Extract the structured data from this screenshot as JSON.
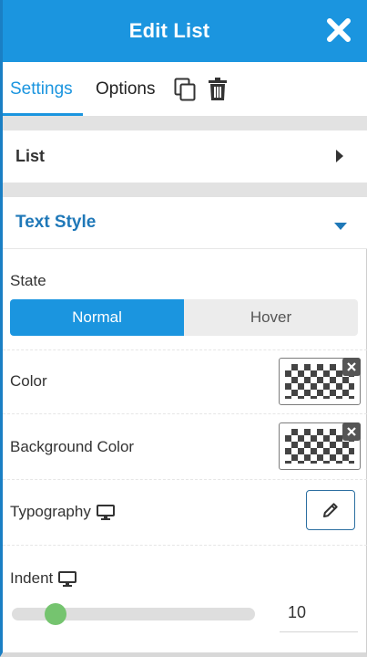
{
  "header": {
    "title": "Edit List",
    "close_icon": "close-icon"
  },
  "tabs": [
    {
      "label": "Settings",
      "active": true
    },
    {
      "label": "Options",
      "active": false
    }
  ],
  "tab_icons": [
    "duplicate-icon",
    "trash-icon"
  ],
  "sections": {
    "list": {
      "title": "List",
      "expanded": false
    },
    "text_style": {
      "title": "Text Style",
      "expanded": true
    }
  },
  "state": {
    "label": "State",
    "options": [
      "Normal",
      "Hover"
    ],
    "selected": "Normal"
  },
  "color": {
    "label": "Color",
    "value": "transparent"
  },
  "background_color": {
    "label": "Background Color",
    "value": "transparent"
  },
  "typography": {
    "label": "Typography",
    "responsive_icon": "desktop-icon",
    "edit_icon": "pencil-icon"
  },
  "indent": {
    "label": "Indent",
    "responsive_icon": "desktop-icon",
    "value": "10",
    "slider_fraction": 0.15
  },
  "colors": {
    "accent": "#1b95df",
    "section_title": "#1f78b8",
    "slider_thumb": "#75c46f"
  }
}
